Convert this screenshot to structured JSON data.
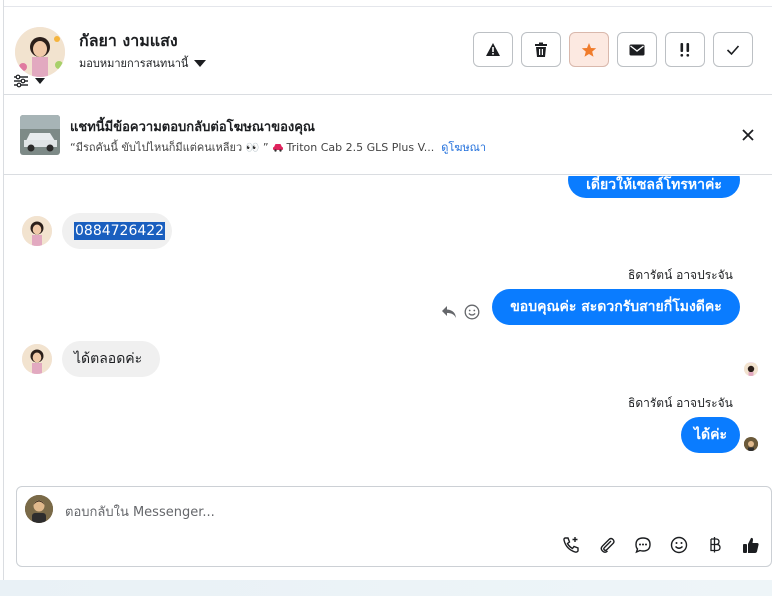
{
  "header": {
    "contact_name": "กัลยา งามแสง",
    "assign_label": "มอบหมายการสนทนานี้",
    "actions": [
      {
        "name": "report-spam-button",
        "icon": "warning-icon"
      },
      {
        "name": "delete-button",
        "icon": "trash-icon"
      },
      {
        "name": "star-button",
        "icon": "star-icon"
      },
      {
        "name": "mark-unread-button",
        "icon": "envelope-icon"
      },
      {
        "name": "follow-up-button",
        "icon": "exclamation-icon"
      },
      {
        "name": "mark-done-button",
        "icon": "check-icon"
      }
    ]
  },
  "ad": {
    "title": "แชทนี้มีข้อความตอบกลับต่อโฆษณาของคุณ",
    "snippet_quote": "“มีรถคันนี้ ขับไปไหนก็มีแต่คนเหลียว 👀 ”",
    "snippet_model": "Triton Cab 2.5 GLS Plus V...",
    "view_ad_link": "ดูโฆษณา"
  },
  "messages": {
    "out_partial": "เดี๋ยวให้เซลล์โทรหาค่ะ",
    "in_phone": "0884726422",
    "sender_1": "ธิดารัตน์ อาจประจัน",
    "out_thanks": "ขอบคุณค่ะ สะดวกรับสายกี่โมงดีคะ",
    "in_anytime": "ได้ตลอดค่ะ",
    "sender_2": "ธิดารัตน์ อาจประจัน",
    "out_ok": "ได้ค่ะ"
  },
  "composer": {
    "placeholder": "ตอบกลับใน Messenger...",
    "tools": [
      "call-add-icon",
      "paperclip-icon",
      "chat-bubble-icon",
      "emoji-icon",
      "baht-icon",
      "thumbs-up-icon"
    ]
  },
  "colors": {
    "outgoing_bubble": "#0a7cff",
    "incoming_bubble": "#f0f0f0",
    "star_active": "#f07c2c",
    "link": "#216fdb"
  }
}
